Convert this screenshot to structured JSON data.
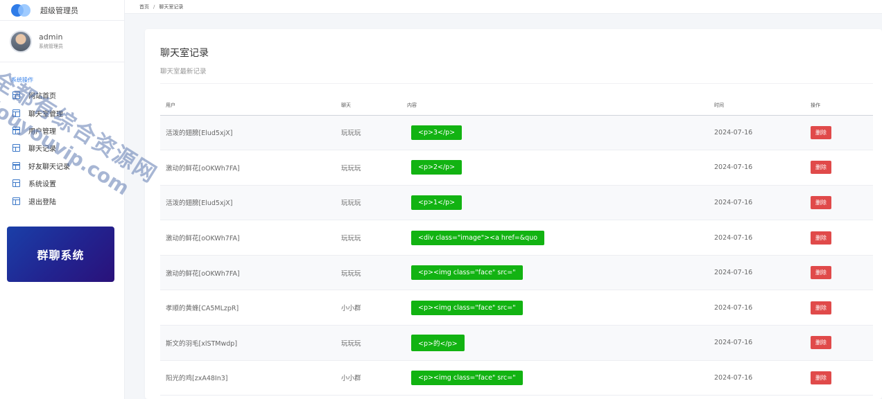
{
  "brand": {
    "title": "超级管理员"
  },
  "user": {
    "name": "admin",
    "role": "系统管理员"
  },
  "sidebar": {
    "section_label": "系统操作",
    "items": [
      {
        "label": "网站首页",
        "icon": "layout-icon"
      },
      {
        "label": "聊天室管理",
        "icon": "layout-icon"
      },
      {
        "label": "用户管理",
        "icon": "layout-icon"
      },
      {
        "label": "聊天记录",
        "icon": "layout-icon"
      },
      {
        "label": "好友聊天记录",
        "icon": "layout-icon"
      },
      {
        "label": "系统设置",
        "icon": "layout-icon"
      },
      {
        "label": "退出登陆",
        "icon": "layout-icon"
      }
    ]
  },
  "promo": {
    "text": "群聊系统"
  },
  "breadcrumb": {
    "home": "首页",
    "separator": "/",
    "current": "聊天室记录"
  },
  "page": {
    "title": "聊天室记录",
    "subtitle": "聊天室最新记录"
  },
  "table": {
    "headers": {
      "user": "用户",
      "chat": "聊天",
      "content": "内容",
      "time": "时间",
      "action": "操作"
    },
    "rows": [
      {
        "user": "活泼的翅膀[Elud5xjX]",
        "chat": "玩玩玩",
        "content": "<p>3</p>",
        "time": "2024-07-16",
        "action": "删除"
      },
      {
        "user": "激动的鲜花[oOKWh7FA]",
        "chat": "玩玩玩",
        "content": "<p>2</p>",
        "time": "2024-07-16",
        "action": "删除"
      },
      {
        "user": "活泼的翅膀[Elud5xjX]",
        "chat": "玩玩玩",
        "content": "<p>1</p>",
        "time": "2024-07-16",
        "action": "删除"
      },
      {
        "user": "激动的鲜花[oOKWh7FA]",
        "chat": "玩玩玩",
        "content": "<div class=\"image\"><a href=&quo",
        "time": "2024-07-16",
        "action": "删除"
      },
      {
        "user": "激动的鲜花[oOKWh7FA]",
        "chat": "玩玩玩",
        "content": "<p><img class=\"face\" src=\"",
        "time": "2024-07-16",
        "action": "删除"
      },
      {
        "user": "孝顺的黄蜂[CA5MLzpR]",
        "chat": "小小群",
        "content": "<p><img class=\"face\" src=\"",
        "time": "2024-07-16",
        "action": "删除"
      },
      {
        "user": "斯文的羽毛[xlSTMwdp]",
        "chat": "玩玩玩",
        "content": "<p>的</p>",
        "time": "2024-07-16",
        "action": "删除"
      },
      {
        "user": "阳光的鸡[zxA48In3]",
        "chat": "小小群",
        "content": "<p><img class=\"face\" src=\"",
        "time": "2024-07-16",
        "action": "删除"
      }
    ]
  },
  "watermark": {
    "line1": "全都有综合资源网",
    "line2": "douyouvip.com"
  },
  "colors": {
    "accent": "#2f7ce8",
    "content_badge": "#12b312",
    "delete_button": "#e04a4a",
    "promo_start": "#1a3fa8",
    "promo_end": "#2a117a"
  }
}
